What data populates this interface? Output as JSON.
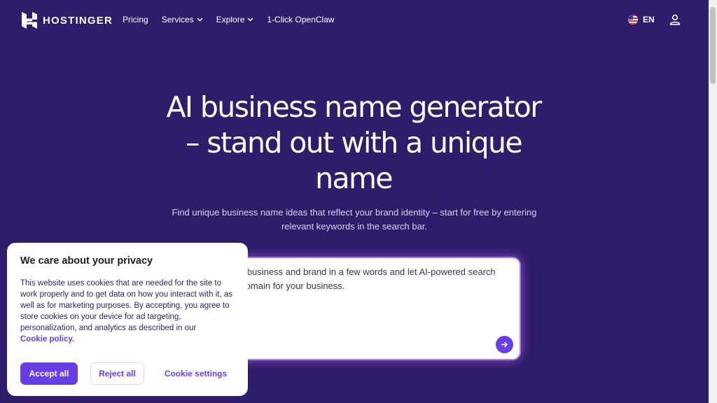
{
  "header": {
    "logo_text": "HOSTINGER",
    "nav": [
      {
        "label": "Pricing",
        "dropdown": false
      },
      {
        "label": "Services",
        "dropdown": true
      },
      {
        "label": "Explore",
        "dropdown": true
      },
      {
        "label": "1-Click OpenClaw",
        "dropdown": false
      }
    ],
    "language": "EN"
  },
  "hero": {
    "title_line1": "AI business name generator",
    "title_line2": "– stand out with a unique",
    "title_line3": "name",
    "subtitle_line1": "Find unique business name ideas that reflect your brand identity – start for free by entering",
    "subtitle_line2": "relevant keywords in the search bar."
  },
  "search": {
    "text_line1": "Describe your business and brand in a few words and let AI-powered search",
    "text_line2": "find the best domain for your business."
  },
  "cookie": {
    "title": "We care about your privacy",
    "body": "This website uses cookies that are needed for the site to work properly and to get data on how you interact with it, as well as for marketing purposes. By accepting, you agree to store cookies on your device for ad targeting, personalization, and analytics as described in our",
    "link": "Cookie policy.",
    "accept_label": "Accept all",
    "reject_label": "Reject all",
    "settings_label": "Cookie settings"
  },
  "colors": {
    "background": "#2f1c6a",
    "accent": "#673de6",
    "search_glow": "#a37af7"
  },
  "icons": {
    "logo": "hostinger-logo-icon",
    "chevron": "chevron-down-icon",
    "flag": "us-flag-icon",
    "user": "user-icon",
    "submit": "arrow-right-icon"
  }
}
